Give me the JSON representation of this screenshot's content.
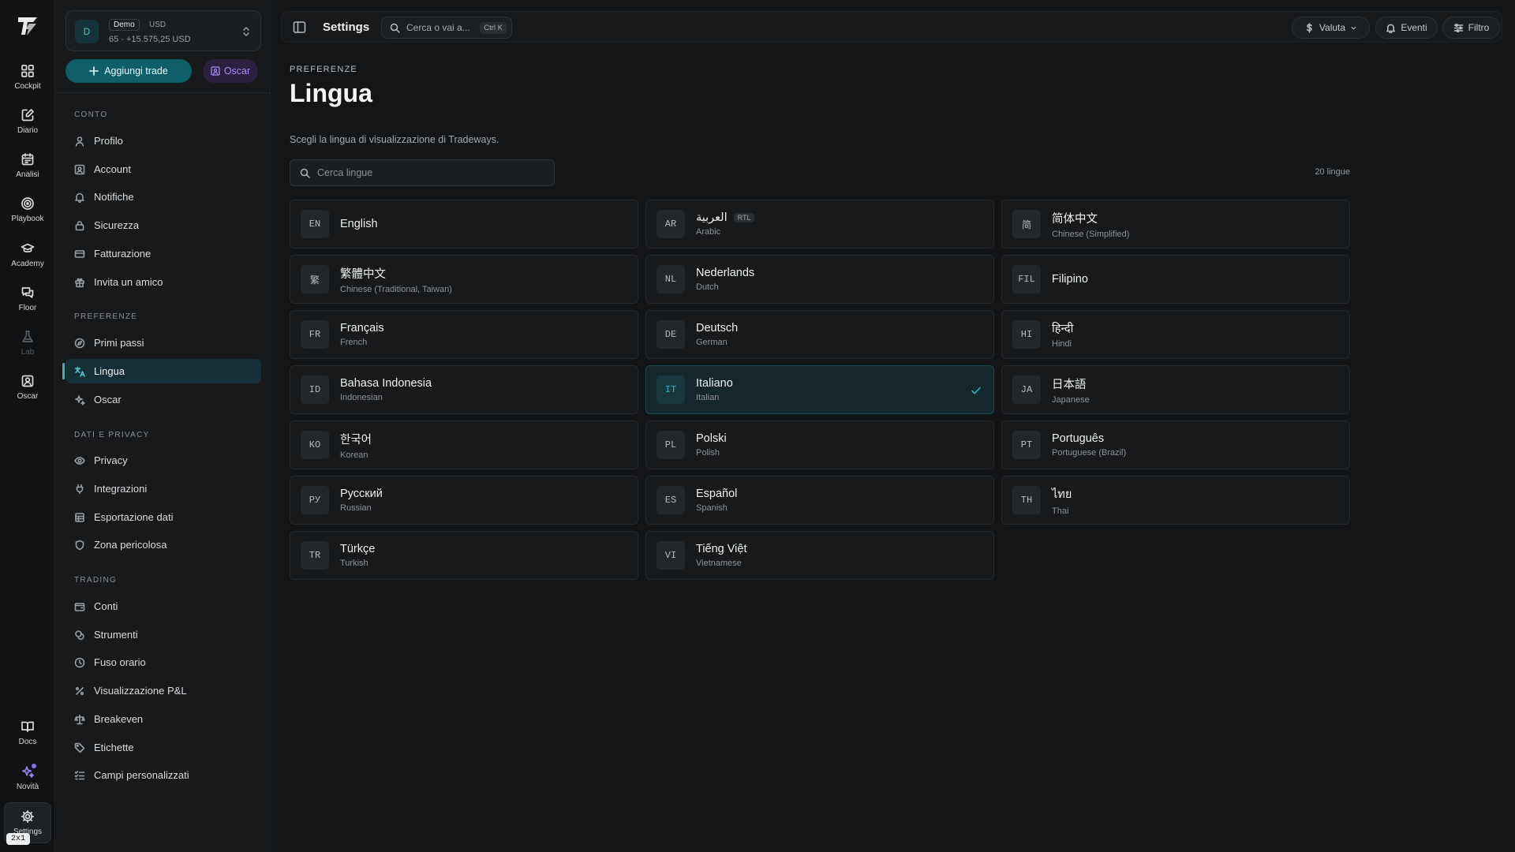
{
  "rail": {
    "items": [
      {
        "label": "Cockpit",
        "icon": "grid-icon"
      },
      {
        "label": "Diario",
        "icon": "journal-icon"
      },
      {
        "label": "Analisi",
        "icon": "calendar-icon"
      },
      {
        "label": "Playbook",
        "icon": "target-icon"
      },
      {
        "label": "Academy",
        "icon": "graduation-cap-icon"
      },
      {
        "label": "Floor",
        "icon": "chat-icon"
      },
      {
        "label": "Lab",
        "icon": "flask-icon"
      },
      {
        "label": "Oscar",
        "icon": "oscar-icon"
      },
      {
        "label": "Docs",
        "icon": "book-icon"
      },
      {
        "label": "Novità",
        "icon": "sparkle-icon"
      },
      {
        "label": "Settings",
        "icon": "gear-icon"
      }
    ],
    "version_badge": "2x1"
  },
  "account": {
    "avatar": "D",
    "badge": "Demo",
    "currency": "USD",
    "summary": "65 · +15.575,25 USD"
  },
  "actions": {
    "add_trade": "Aggiungi trade",
    "oscar": "Oscar"
  },
  "sidebar": {
    "sections": [
      {
        "title": "CONTO",
        "items": [
          "Profilo",
          "Account",
          "Notifiche",
          "Sicurezza",
          "Fatturazione",
          "Invita un amico"
        ]
      },
      {
        "title": "PREFERENZE",
        "items": [
          "Primi passi",
          "Lingua",
          "Oscar"
        ]
      },
      {
        "title": "DATI E PRIVACY",
        "items": [
          "Privacy",
          "Integrazioni",
          "Esportazione dati",
          "Zona pericolosa"
        ]
      },
      {
        "title": "TRADING",
        "items": [
          "Conti",
          "Strumenti",
          "Fuso orario",
          "Visualizzazione P&L",
          "Breakeven",
          "Etichette",
          "Campi personalizzati"
        ]
      }
    ],
    "active": "Lingua"
  },
  "topbar": {
    "title": "Settings",
    "search_placeholder": "Cerca o vai a...",
    "shortcut": "Ctrl K",
    "currency_btn": "Valuta",
    "events_btn": "Eventi",
    "filter_btn": "Filtro"
  },
  "page": {
    "eyebrow": "PREFERENZE",
    "title": "Lingua",
    "description": "Scegli la lingua di visualizzazione di Tradeways.",
    "search_placeholder": "Cerca lingue",
    "count": "20 lingue",
    "rtl_label": "RTL"
  },
  "languages": [
    {
      "code": "EN",
      "native": "English",
      "english": ""
    },
    {
      "code": "AR",
      "native": "العربية",
      "english": "Arabic",
      "rtl": true
    },
    {
      "code": "简",
      "native": "简体中文",
      "english": "Chinese (Simplified)"
    },
    {
      "code": "繁",
      "native": "繁體中文",
      "english": "Chinese (Traditional, Taiwan)"
    },
    {
      "code": "NL",
      "native": "Nederlands",
      "english": "Dutch"
    },
    {
      "code": "FIL",
      "native": "Filipino",
      "english": ""
    },
    {
      "code": "FR",
      "native": "Français",
      "english": "French"
    },
    {
      "code": "DE",
      "native": "Deutsch",
      "english": "German"
    },
    {
      "code": "HI",
      "native": "हिन्दी",
      "english": "Hindi"
    },
    {
      "code": "ID",
      "native": "Bahasa Indonesia",
      "english": "Indonesian"
    },
    {
      "code": "IT",
      "native": "Italiano",
      "english": "Italian",
      "selected": true
    },
    {
      "code": "JA",
      "native": "日本語",
      "english": "Japanese"
    },
    {
      "code": "KO",
      "native": "한국어",
      "english": "Korean"
    },
    {
      "code": "PL",
      "native": "Polski",
      "english": "Polish"
    },
    {
      "code": "PT",
      "native": "Português",
      "english": "Portuguese (Brazil)"
    },
    {
      "code": "РУ",
      "native": "Русский",
      "english": "Russian"
    },
    {
      "code": "ES",
      "native": "Español",
      "english": "Spanish"
    },
    {
      "code": "TH",
      "native": "ไทย",
      "english": "Thai"
    },
    {
      "code": "TR",
      "native": "Türkçe",
      "english": "Turkish"
    },
    {
      "code": "VI",
      "native": "Tiếng Việt",
      "english": "Vietnamese"
    }
  ],
  "colors": {
    "accent": "#2ab5c4",
    "accent_button": "#0e5f6a",
    "oscar_purple": "#a98ef5",
    "background": "#131517"
  }
}
